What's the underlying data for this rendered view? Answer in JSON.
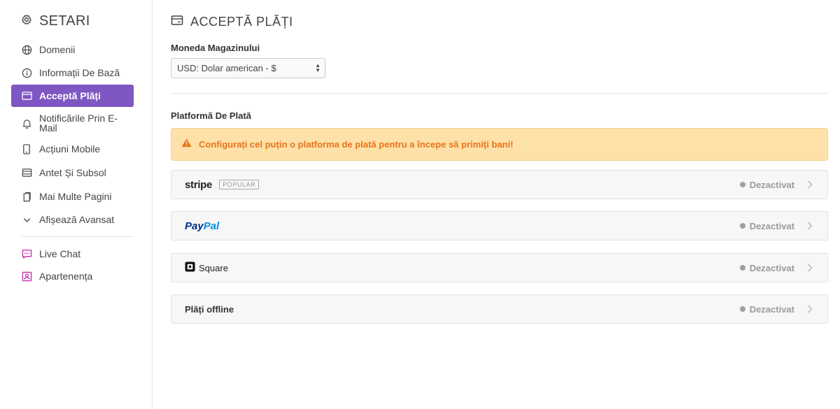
{
  "sidebar": {
    "title": "SETARI",
    "items": [
      {
        "label": "Domenii",
        "icon": "globe-icon"
      },
      {
        "label": "Informații De Bază",
        "icon": "info-icon"
      },
      {
        "label": "Acceptă Plăți",
        "icon": "card-icon",
        "active": true
      },
      {
        "label": "Notificările Prin E-Mail",
        "icon": "bell-icon"
      },
      {
        "label": "Acțiuni Mobile",
        "icon": "mobile-icon"
      },
      {
        "label": "Antet Și Subsol",
        "icon": "layout-icon"
      },
      {
        "label": "Mai Multe Pagini",
        "icon": "pages-icon"
      },
      {
        "label": "Afișează Avansat",
        "icon": "chevron-down-icon"
      }
    ],
    "extra_items": [
      {
        "label": "Live Chat",
        "icon": "chat-icon"
      },
      {
        "label": "Apartenența",
        "icon": "member-icon"
      }
    ]
  },
  "main": {
    "title": "ACCEPTĂ PLĂȚI",
    "currency_label": "Moneda Magazinului",
    "currency_value": "USD: Dolar american - $",
    "platform_label": "Platformă De Plată",
    "alert": "Configurați cel puțin o platforma de plată pentru a începe să primiți bani!",
    "providers": [
      {
        "name": "stripe",
        "badge": "POPULAR",
        "status": "Dezactivat"
      },
      {
        "name_pay": "Pay",
        "name_pal": "Pal",
        "status": "Dezactivat"
      },
      {
        "name": "Square",
        "status": "Dezactivat"
      },
      {
        "name": "Plăți offline",
        "status": "Dezactivat"
      }
    ]
  },
  "colors": {
    "accent": "#7e57c2",
    "alert_bg": "#fee1a8",
    "alert_text": "#e8741c",
    "chat_icon": "#c02aa8"
  }
}
